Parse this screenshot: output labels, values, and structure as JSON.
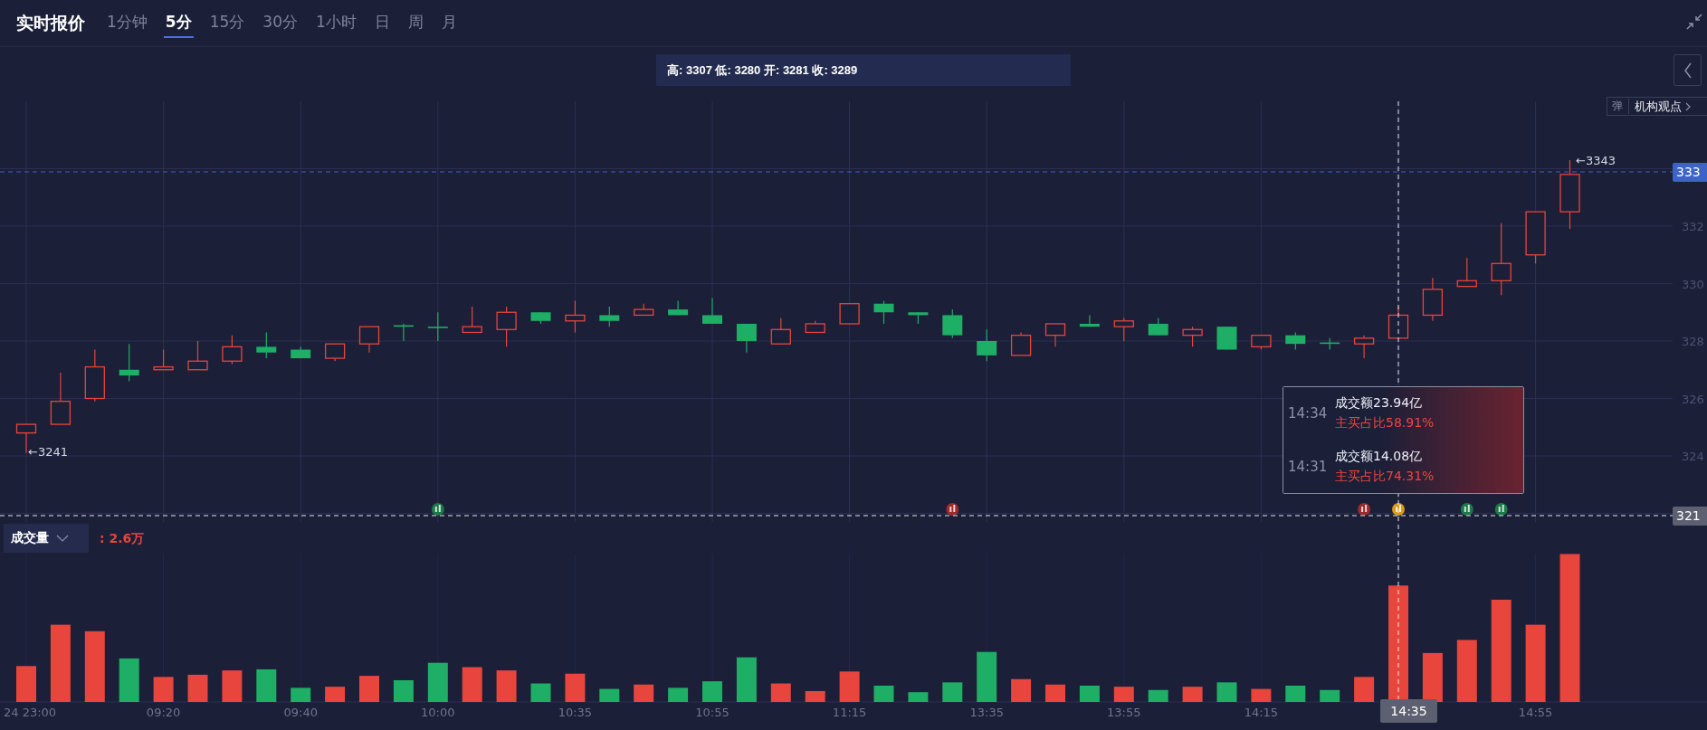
{
  "header": {
    "title": "实时报价",
    "tabs": [
      {
        "label": "1分钟",
        "selected": false
      },
      {
        "label": "5分",
        "selected": true
      },
      {
        "label": "15分",
        "selected": false
      },
      {
        "label": "30分",
        "selected": false
      },
      {
        "label": "1小时",
        "selected": false
      },
      {
        "label": "日",
        "selected": false
      },
      {
        "label": "周",
        "selected": false
      },
      {
        "label": "月",
        "selected": false
      }
    ]
  },
  "ohlc_summary": "高: 3307 低: 3280 开: 3281 收: 3289",
  "view_toggle": {
    "icon_text": "弹",
    "label": "机构观点"
  },
  "price_axis": {
    "labels": [
      "332",
      "330",
      "328",
      "326",
      "324"
    ],
    "current_price": "333",
    "crosshair_price": "321"
  },
  "price_marks": {
    "high": "←3343",
    "low": "←3241"
  },
  "time_axis": {
    "labels": [
      "24 23:00",
      "09:20",
      "09:40",
      "10:00",
      "10:35",
      "10:55",
      "11:15",
      "13:35",
      "13:55",
      "14:15",
      "14:55"
    ],
    "crosshair_time": "14:35"
  },
  "volume": {
    "selector": "成交量",
    "reading": ": 2.6万"
  },
  "tooltip": {
    "rows": [
      {
        "time": "14:34",
        "amount": "成交额23.94亿",
        "ratio": "主买占比58.91%"
      },
      {
        "time": "14:31",
        "amount": "成交额14.08亿",
        "ratio": "主买占比74.31%"
      }
    ]
  }
}
